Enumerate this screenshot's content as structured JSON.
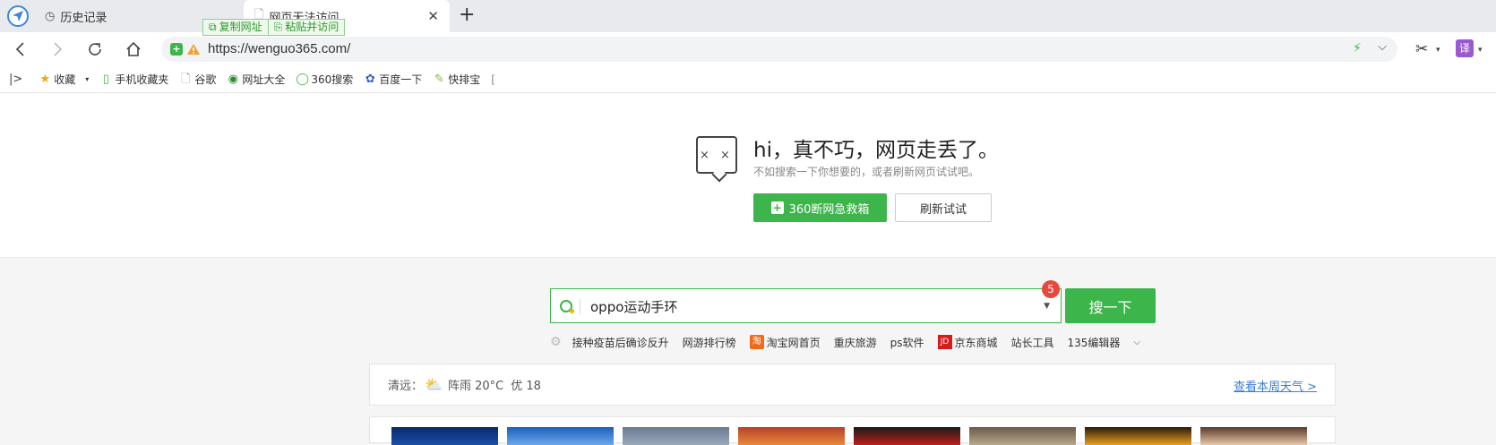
{
  "tabs": {
    "history_label": "历史记录",
    "active_label": "网页无法访问"
  },
  "copy_popup": {
    "copy_url": "复制网址",
    "paste_visit": "粘贴并访问"
  },
  "address_bar": {
    "url": "https://wenguo365.com/"
  },
  "toolbar": {
    "translate_label": "译"
  },
  "bookmarks": [
    {
      "label": "收藏",
      "icon": "star-icon"
    },
    {
      "label": "手机收藏夹",
      "icon": "phone-icon"
    },
    {
      "label": "谷歌",
      "icon": "page-icon"
    },
    {
      "label": "网址大全",
      "icon": "globe-icon"
    },
    {
      "label": "360搜索",
      "icon": "search360-icon"
    },
    {
      "label": "百度一下",
      "icon": "baidu-paw-icon"
    },
    {
      "label": "快排宝",
      "icon": "leaf-icon"
    },
    {
      "label": "[",
      "icon": ""
    }
  ],
  "error": {
    "title": "hi，真不巧，网页走丢了。",
    "subtitle": "不如搜索一下你想要的，或者刷新网页试试吧。",
    "rescue_button": "360断网急救箱",
    "refresh_button": "刷新试试"
  },
  "search": {
    "query": "oppo运动手环",
    "badge_count": "5",
    "button": "搜一下"
  },
  "hot_links": [
    "接种疫苗后确诊反升",
    "网游排行榜",
    "淘宝网首页",
    "重庆旅游",
    "ps软件",
    "京东商城",
    "站长工具",
    "135编辑器"
  ],
  "hot_icons": {
    "taobao": "淘",
    "jd": "JD"
  },
  "weather": {
    "city": "清远：",
    "condition": "阵雨 20°C",
    "air": "优 18",
    "link": "查看本周天气 >"
  },
  "colors": {
    "accent_green": "#3cb54a",
    "link_blue": "#3a7dd8",
    "badge_red": "#e8473b"
  }
}
